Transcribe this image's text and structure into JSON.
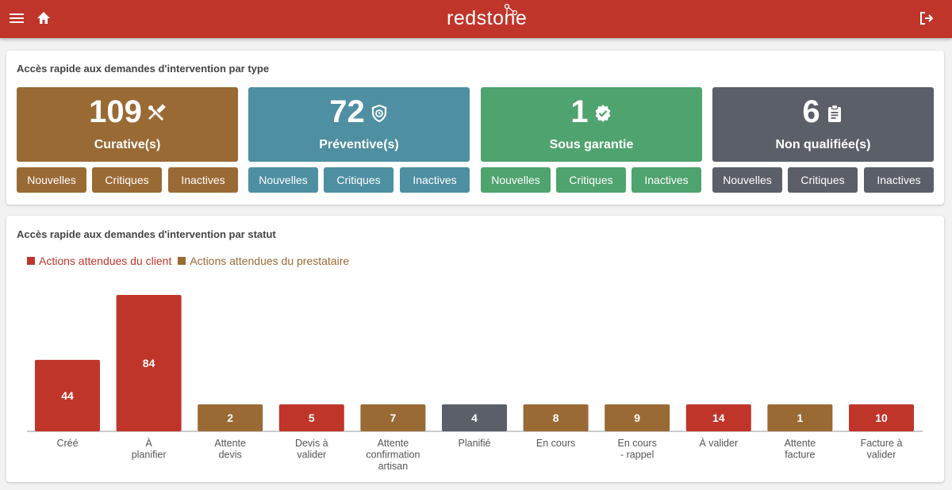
{
  "header": {
    "logo_text": "redstone",
    "menu_icon": "menu-icon",
    "home_icon": "home-icon",
    "logout_icon": "logout-icon"
  },
  "type_section": {
    "title": "Accès rapide aux demandes d'intervention par type",
    "tiles": [
      {
        "count": "109",
        "label": "Curative(s)",
        "icon": "tools-icon",
        "color": "#9a6a35",
        "buttons": [
          "Nouvelles",
          "Critiques",
          "Inactives"
        ]
      },
      {
        "count": "72",
        "label": "Préventive(s)",
        "icon": "shield-clock-icon",
        "color": "#4e8fa2",
        "buttons": [
          "Nouvelles",
          "Critiques",
          "Inactives"
        ]
      },
      {
        "count": "1",
        "label": "Sous garantie",
        "icon": "verified-badge-icon",
        "color": "#4fa36e",
        "buttons": [
          "Nouvelles",
          "Critiques",
          "Inactives"
        ]
      },
      {
        "count": "6",
        "label": "Non qualifiée(s)",
        "icon": "clipboard-icon",
        "color": "#5b5f68",
        "buttons": [
          "Nouvelles",
          "Critiques",
          "Inactives"
        ]
      }
    ]
  },
  "status_section": {
    "title": "Accès rapide aux demandes d'intervention par statut"
  },
  "chart_data": {
    "type": "bar",
    "legend": [
      {
        "name": "Actions attendues du client",
        "color": "#c0352a"
      },
      {
        "name": "Actions attendues du prestataire",
        "color": "#9a6a35"
      }
    ],
    "legend_position": "top-left",
    "categories": [
      [
        "Créé"
      ],
      [
        "À",
        "planifier"
      ],
      [
        "Attente",
        "devis"
      ],
      [
        "Devis à",
        "valider"
      ],
      [
        "Attente",
        "confirmation",
        "artisan"
      ],
      [
        "Planifié"
      ],
      [
        "En cours"
      ],
      [
        "En cours",
        "- rappel"
      ],
      [
        "À valider"
      ],
      [
        "Attente",
        "facture"
      ],
      [
        "Facture à",
        "valider"
      ]
    ],
    "values": [
      44,
      84,
      2,
      5,
      7,
      4,
      8,
      9,
      14,
      1,
      10
    ],
    "colors": [
      "#c0352a",
      "#c0352a",
      "#9a6a35",
      "#c0352a",
      "#9a6a35",
      "#5b5f68",
      "#9a6a35",
      "#9a6a35",
      "#c0352a",
      "#9a6a35",
      "#c0352a"
    ],
    "grid": false,
    "ylim": [
      0,
      84
    ]
  }
}
